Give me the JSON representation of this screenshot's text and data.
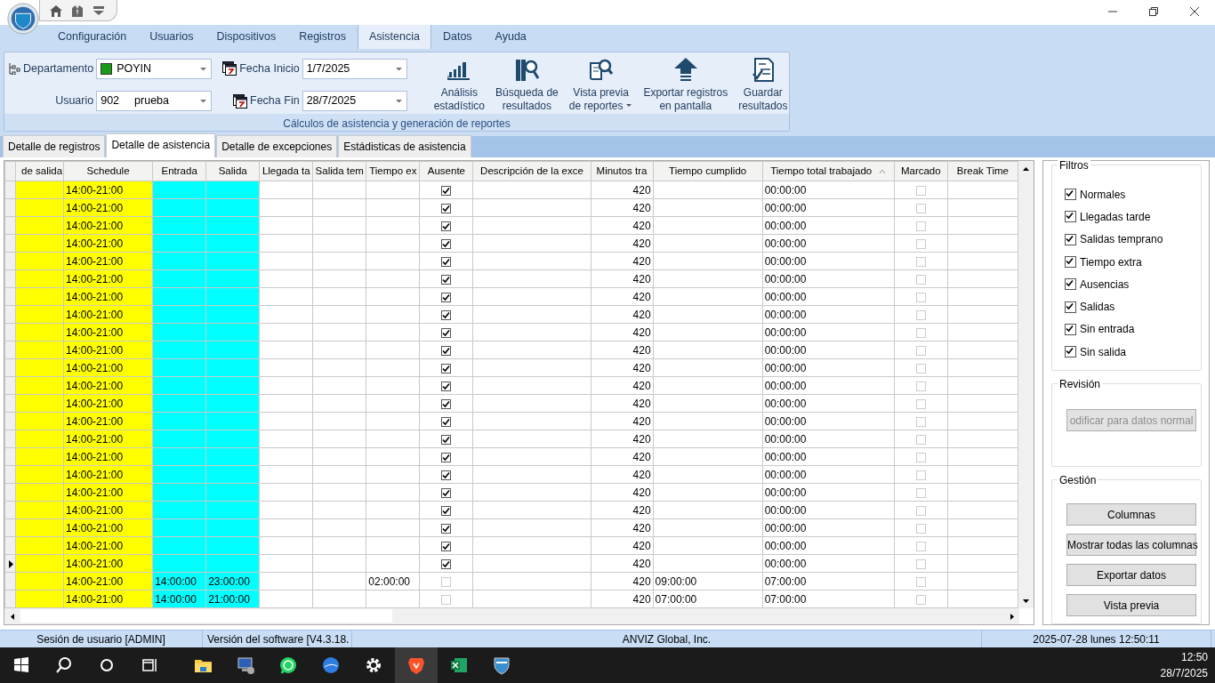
{
  "menu_tabs": [
    {
      "label": "Configuración",
      "selected": false
    },
    {
      "label": "Usuarios",
      "selected": false
    },
    {
      "label": "Dispositivos",
      "selected": false
    },
    {
      "label": "Registros",
      "selected": false
    },
    {
      "label": "Asistencia",
      "selected": true
    },
    {
      "label": "Datos",
      "selected": false
    },
    {
      "label": "Ayuda",
      "selected": false
    }
  ],
  "ribbon": {
    "department": {
      "label": "Departamento",
      "value": "POYIN"
    },
    "user": {
      "label": "Usuario",
      "id": "902",
      "name": "prueba"
    },
    "start_date": {
      "label": "Fecha Inicio",
      "value": "1/7/2025"
    },
    "end_date": {
      "label": "Fecha Fin",
      "value": "28/7/2025"
    },
    "actions": [
      {
        "kind": "chart",
        "lines": [
          "Análisis",
          "estadístico"
        ],
        "has_menu": false
      },
      {
        "kind": "search",
        "lines": [
          "Búsqueda de",
          "resultados"
        ],
        "has_menu": false
      },
      {
        "kind": "preview",
        "lines": [
          "Vista previa",
          "de reportes"
        ],
        "has_menu": true
      },
      {
        "kind": "export",
        "lines": [
          "Exportar registros",
          "en pantalla"
        ],
        "has_menu": false
      },
      {
        "kind": "save",
        "lines": [
          "Guardar",
          "resultados"
        ],
        "has_menu": false
      }
    ],
    "group_label": "Cálculos de asistencia y generación de reportes"
  },
  "doc_tabs": [
    {
      "label": "Detalle de registros",
      "selected": false
    },
    {
      "label": "Detalle de asistencia",
      "selected": true
    },
    {
      "label": "Detalle de excepciones",
      "selected": false
    },
    {
      "label": "Estádisticas de asistencia",
      "selected": false
    }
  ],
  "table": {
    "columns": [
      "de salida",
      "Schedule",
      "Entrada",
      "Salida",
      "Llegada ta",
      "Salida tem",
      "Tiempo ex",
      "Ausente",
      "Descripción de la exce",
      "Minutos tra",
      "Tiempo cumplido",
      "Tiempo total trabajado",
      "Marcado",
      "Break Time"
    ],
    "rows": [
      {
        "schedule": "14:00-21:00",
        "ausente": true,
        "minutos": "420",
        "tiempo_total": "00:00:00",
        "marcado": false,
        "current": false
      },
      {
        "schedule": "14:00-21:00",
        "ausente": true,
        "minutos": "420",
        "tiempo_total": "00:00:00",
        "marcado": false,
        "current": false
      },
      {
        "schedule": "14:00-21:00",
        "ausente": true,
        "minutos": "420",
        "tiempo_total": "00:00:00",
        "marcado": false,
        "current": false
      },
      {
        "schedule": "14:00-21:00",
        "ausente": true,
        "minutos": "420",
        "tiempo_total": "00:00:00",
        "marcado": false,
        "current": false
      },
      {
        "schedule": "14:00-21:00",
        "ausente": true,
        "minutos": "420",
        "tiempo_total": "00:00:00",
        "marcado": false,
        "current": false
      },
      {
        "schedule": "14:00-21:00",
        "ausente": true,
        "minutos": "420",
        "tiempo_total": "00:00:00",
        "marcado": false,
        "current": false
      },
      {
        "schedule": "14:00-21:00",
        "ausente": true,
        "minutos": "420",
        "tiempo_total": "00:00:00",
        "marcado": false,
        "current": false
      },
      {
        "schedule": "14:00-21:00",
        "ausente": true,
        "minutos": "420",
        "tiempo_total": "00:00:00",
        "marcado": false,
        "current": false
      },
      {
        "schedule": "14:00-21:00",
        "ausente": true,
        "minutos": "420",
        "tiempo_total": "00:00:00",
        "marcado": false,
        "current": false
      },
      {
        "schedule": "14:00-21:00",
        "ausente": true,
        "minutos": "420",
        "tiempo_total": "00:00:00",
        "marcado": false,
        "current": false
      },
      {
        "schedule": "14:00-21:00",
        "ausente": true,
        "minutos": "420",
        "tiempo_total": "00:00:00",
        "marcado": false,
        "current": false
      },
      {
        "schedule": "14:00-21:00",
        "ausente": true,
        "minutos": "420",
        "tiempo_total": "00:00:00",
        "marcado": false,
        "current": false
      },
      {
        "schedule": "14:00-21:00",
        "ausente": true,
        "minutos": "420",
        "tiempo_total": "00:00:00",
        "marcado": false,
        "current": false
      },
      {
        "schedule": "14:00-21:00",
        "ausente": true,
        "minutos": "420",
        "tiempo_total": "00:00:00",
        "marcado": false,
        "current": false
      },
      {
        "schedule": "14:00-21:00",
        "ausente": true,
        "minutos": "420",
        "tiempo_total": "00:00:00",
        "marcado": false,
        "current": false
      },
      {
        "schedule": "14:00-21:00",
        "ausente": true,
        "minutos": "420",
        "tiempo_total": "00:00:00",
        "marcado": false,
        "current": false
      },
      {
        "schedule": "14:00-21:00",
        "ausente": true,
        "minutos": "420",
        "tiempo_total": "00:00:00",
        "marcado": false,
        "current": false
      },
      {
        "schedule": "14:00-21:00",
        "ausente": true,
        "minutos": "420",
        "tiempo_total": "00:00:00",
        "marcado": false,
        "current": false
      },
      {
        "schedule": "14:00-21:00",
        "ausente": true,
        "minutos": "420",
        "tiempo_total": "00:00:00",
        "marcado": false,
        "current": false
      },
      {
        "schedule": "14:00-21:00",
        "ausente": true,
        "minutos": "420",
        "tiempo_total": "00:00:00",
        "marcado": false,
        "current": false
      },
      {
        "schedule": "14:00-21:00",
        "ausente": true,
        "minutos": "420",
        "tiempo_total": "00:00:00",
        "marcado": false,
        "current": false
      },
      {
        "schedule": "14:00-21:00",
        "ausente": true,
        "minutos": "420",
        "tiempo_total": "00:00:00",
        "marcado": false,
        "current": true
      },
      {
        "schedule": "14:00-21:00",
        "entrada": "14:00:00",
        "salida": "23:00:00",
        "tiempo_extra": "02:00:00",
        "ausente": false,
        "minutos": "420",
        "tiempo_cumplido": "09:00:00",
        "tiempo_total": "07:00:00",
        "marcado": false,
        "current": false
      },
      {
        "schedule": "14:00-21:00",
        "entrada": "14:00:00",
        "salida": "21:00:00",
        "ausente": false,
        "minutos": "420",
        "tiempo_cumplido": "07:00:00",
        "tiempo_total": "07:00:00",
        "marcado": false,
        "current": false
      }
    ]
  },
  "filters": {
    "title": "Filtros",
    "items": [
      {
        "label": "Normales",
        "checked": true
      },
      {
        "label": "Llegadas tarde",
        "checked": true
      },
      {
        "label": "Salidas temprano",
        "checked": true
      },
      {
        "label": "Tiempo extra",
        "checked": true
      },
      {
        "label": "Ausencias",
        "checked": true
      },
      {
        "label": "Salidas",
        "checked": true
      },
      {
        "label": "Sin entrada",
        "checked": true
      },
      {
        "label": "Sin salida",
        "checked": true
      }
    ]
  },
  "review": {
    "title": "Revisión",
    "button": {
      "label": "odificar para datos normal",
      "disabled": true
    }
  },
  "management": {
    "title": "Gestión",
    "buttons": [
      "Columnas",
      "Mostrar todas las columnas",
      "Exportar datos",
      "Vista previa"
    ]
  },
  "status_bar": {
    "session": "Sesión de usuario  [ADMIN]",
    "version": "Versión del software  [V4.3.18.",
    "company": "ANVIZ Global, Inc.",
    "datetime": "2025-07-28 lunes 12:50:11"
  },
  "taskbar": {
    "time": "12:50",
    "date": "28/7/2025"
  }
}
